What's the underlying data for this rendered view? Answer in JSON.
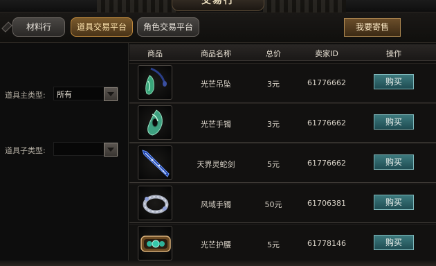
{
  "window": {
    "title": "交易行"
  },
  "tabs": [
    {
      "label": "材料行",
      "active": false
    },
    {
      "label": "道具交易平台",
      "active": true
    },
    {
      "label": "角色交易平台",
      "active": false
    }
  ],
  "actions": {
    "sell_label": "我要寄售"
  },
  "filters": {
    "main_type": {
      "label": "道具主类型:",
      "value": "所有"
    },
    "sub_type": {
      "label": "道具子类型:",
      "value": ""
    }
  },
  "table": {
    "headers": {
      "item": "商品",
      "name": "商品名称",
      "price": "总价",
      "seller": "卖家ID",
      "action": "操作"
    },
    "rows": [
      {
        "icon": "jade-pendant-icon",
        "name": "光芒吊坠",
        "price": "3元",
        "seller": "61776662",
        "buy_label": "购买"
      },
      {
        "icon": "jade-bracelet-icon",
        "name": "光芒手镯",
        "price": "3元",
        "seller": "61776662",
        "buy_label": "购买"
      },
      {
        "icon": "blue-serpent-sword-icon",
        "name": "天界灵蛇剑",
        "price": "5元",
        "seller": "61776662",
        "buy_label": "购买"
      },
      {
        "icon": "silver-bracelet-icon",
        "name": "风域手镯",
        "price": "50元",
        "seller": "61706381",
        "buy_label": "购买"
      },
      {
        "icon": "jeweled-belt-icon",
        "name": "光芒护腰",
        "price": "5元",
        "seller": "61778146",
        "buy_label": "购买"
      }
    ]
  },
  "colors": {
    "accent_gold": "#c08a3e",
    "buy_button": "#2f6a70",
    "background": "#0b0b0b"
  }
}
